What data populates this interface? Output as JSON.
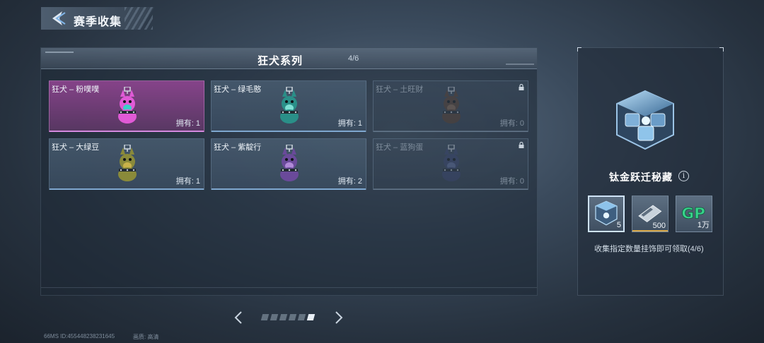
{
  "header": {
    "title": "赛季收集"
  },
  "series": {
    "title": "狂犬系列",
    "progress": "4/6",
    "cards": [
      {
        "name": "狂犬 – 粉噗噗",
        "count": "拥有: 1",
        "state": "selected",
        "color": "#e05ad6",
        "accent": "#3ad0c8"
      },
      {
        "name": "狂犬 – 绿毛憨",
        "count": "拥有: 1",
        "state": "owned",
        "color": "#2a8f88",
        "accent": "#7fe0d4"
      },
      {
        "name": "狂犬 – 土旺财",
        "count": "拥有: 0",
        "state": "locked",
        "color": "#5a4030",
        "accent": "#8a6a50"
      },
      {
        "name": "狂犬 – 大绿豆",
        "count": "拥有: 1",
        "state": "owned",
        "color": "#8a8a3a",
        "accent": "#c9b24a"
      },
      {
        "name": "狂犬 – 紫靛行",
        "count": "拥有: 2",
        "state": "owned",
        "color": "#6a4a9a",
        "accent": "#b08ad8"
      },
      {
        "name": "狂犬 – 蓝狗蛋",
        "count": "拥有: 0",
        "state": "locked",
        "color": "#3a4670",
        "accent": "#6070a0"
      }
    ]
  },
  "pagination": {
    "total": 6,
    "active_index": 5
  },
  "reward": {
    "title": "钛金跃迁秘藏",
    "items": [
      {
        "icon": "crystal-box-icon",
        "qty": "5",
        "bar": ""
      },
      {
        "icon": "ticket-icon",
        "qty": "500",
        "bar": "#d8a94a"
      },
      {
        "icon": "gp-coin-icon",
        "qty": "1万",
        "bar": ""
      }
    ],
    "description": "收集指定数量挂饰即可领取(4/6)"
  },
  "footer": {
    "left": "66MS  ID:455448238231645",
    "right": "画质: 高清"
  }
}
